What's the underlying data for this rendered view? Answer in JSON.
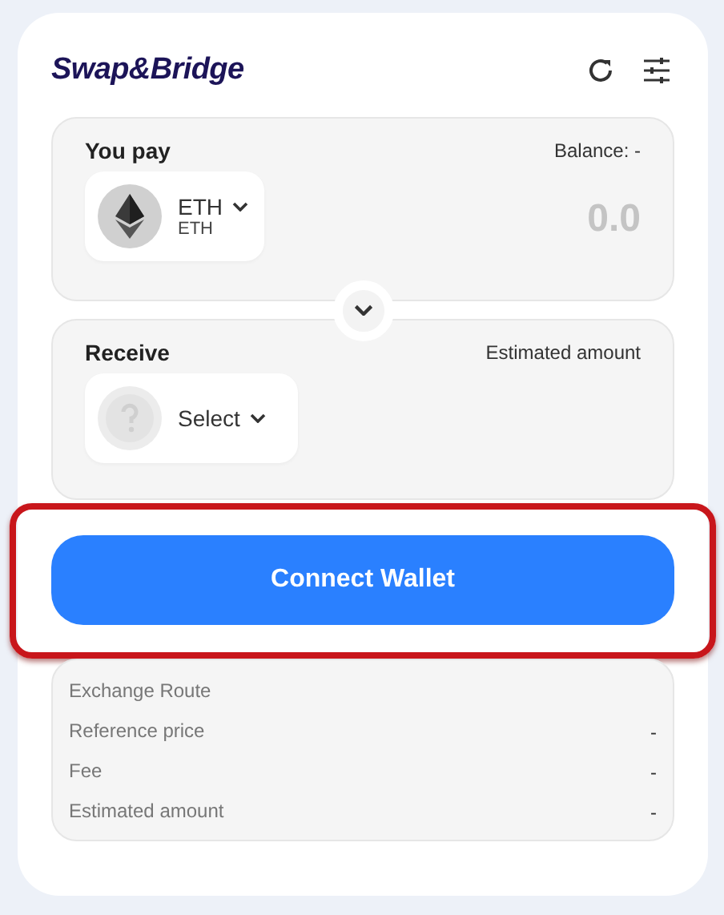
{
  "brand": "Swap&Bridge",
  "pay": {
    "label": "You pay",
    "balance": "Balance: -",
    "token": {
      "symbol": "ETH",
      "network": "ETH"
    },
    "amount": "0.0"
  },
  "receive": {
    "label": "Receive",
    "hint": "Estimated amount",
    "token": {
      "symbol": "Select"
    }
  },
  "connect": {
    "label": "Connect Wallet",
    "highlighted": true
  },
  "details": [
    {
      "label": "Exchange Route"
    },
    {
      "label": "Reference price",
      "value": "-"
    },
    {
      "label": "Fee",
      "value": "-"
    },
    {
      "label": "Estimated amount",
      "value": "-"
    }
  ]
}
